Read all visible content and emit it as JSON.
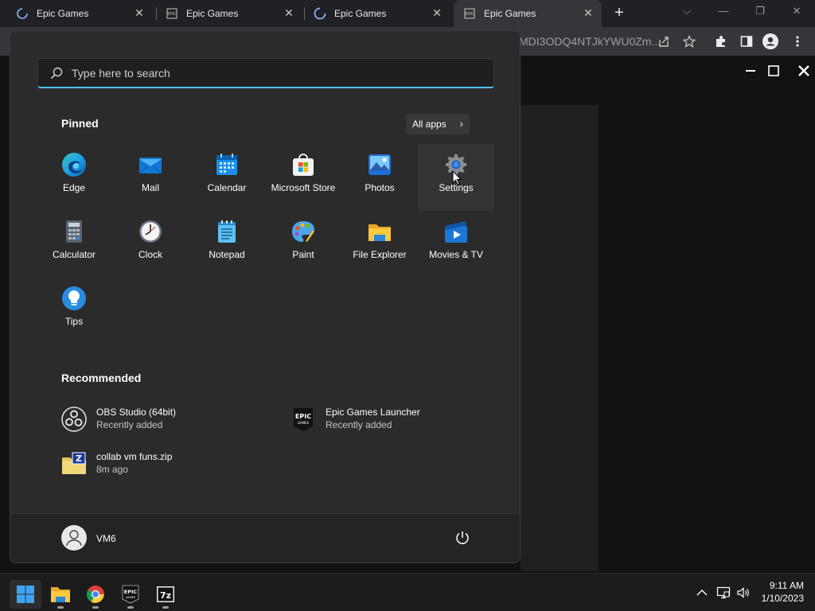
{
  "browser": {
    "tabs": [
      {
        "title": "Epic Games",
        "state": "loading"
      },
      {
        "title": "Epic Games",
        "state": "loaded"
      },
      {
        "title": "Epic Games",
        "state": "loading"
      },
      {
        "title": "Epic Games",
        "state": "active"
      }
    ],
    "url_fragment": "MDI3ODQ4NTJkYWU0Zm..."
  },
  "start_menu": {
    "search_placeholder": "Type here to search",
    "pinned_title": "Pinned",
    "all_apps_label": "All apps",
    "pinned_apps": [
      {
        "label": "Edge",
        "icon": "edge-icon"
      },
      {
        "label": "Mail",
        "icon": "mail-icon"
      },
      {
        "label": "Calendar",
        "icon": "calendar-icon"
      },
      {
        "label": "Microsoft Store",
        "icon": "store-icon"
      },
      {
        "label": "Photos",
        "icon": "photos-icon"
      },
      {
        "label": "Settings",
        "icon": "gear-icon"
      },
      {
        "label": "Calculator",
        "icon": "calculator-icon"
      },
      {
        "label": "Clock",
        "icon": "clock-icon"
      },
      {
        "label": "Notepad",
        "icon": "notepad-icon"
      },
      {
        "label": "Paint",
        "icon": "paint-icon"
      },
      {
        "label": "File Explorer",
        "icon": "folder-icon"
      },
      {
        "label": "Movies & TV",
        "icon": "movies-icon"
      },
      {
        "label": "Tips",
        "icon": "lightbulb-icon"
      }
    ],
    "recommended_title": "Recommended",
    "recommended": [
      {
        "title": "OBS Studio (64bit)",
        "subtitle": "Recently added",
        "icon": "obs-icon"
      },
      {
        "title": "Epic Games Launcher",
        "subtitle": "Recently added",
        "icon": "epic-icon"
      },
      {
        "title": "collab vm funs.zip",
        "subtitle": "8m ago",
        "icon": "zip-icon"
      }
    ],
    "user_name": "VM6"
  },
  "taskbar": {
    "apps": [
      "start-icon",
      "file-explorer-icon",
      "chrome-icon",
      "epic-games-icon",
      "7zip-icon"
    ],
    "time": "9:11 AM",
    "date": "1/10/2023"
  },
  "colors": {
    "accent": "#4cc2ff",
    "start_bg": "#2b2b2b",
    "taskbar_bg": "#1c1c1c"
  }
}
